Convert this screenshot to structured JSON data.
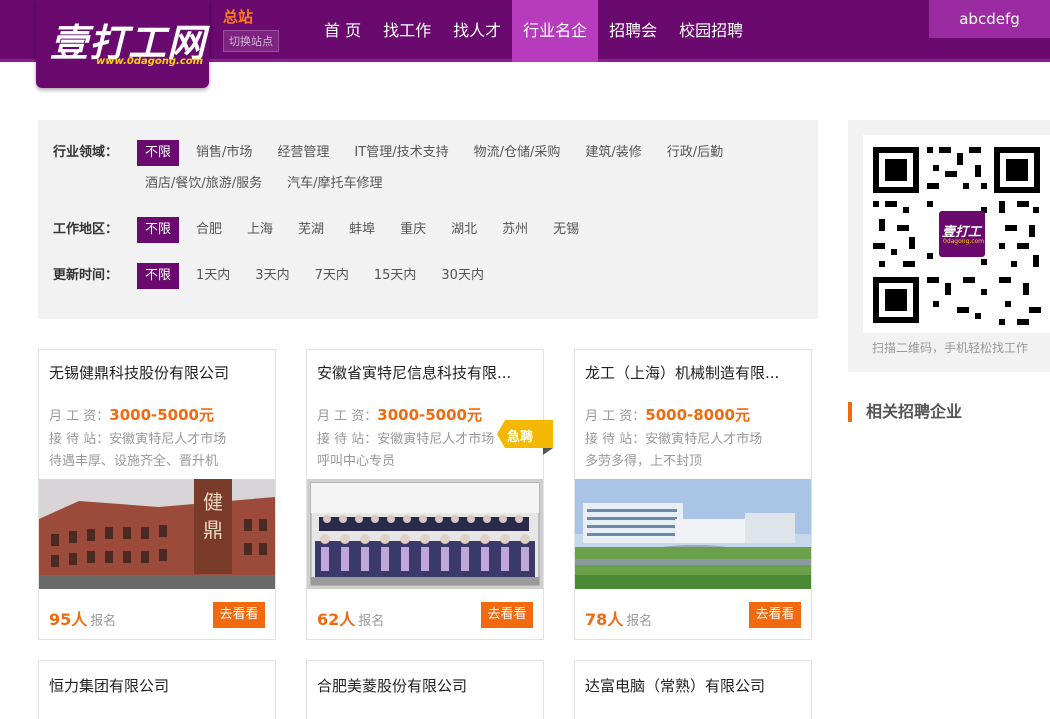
{
  "header": {
    "logo_text": "壹打工网",
    "logo_url": "www.0dagong.com",
    "site_name": "总站",
    "switch_label": "切换站点",
    "nav": [
      "首 页",
      "找工作",
      "找人才",
      "行业名企",
      "招聘会",
      "校园招聘"
    ],
    "active_nav": 3,
    "username": "abcdefg"
  },
  "filters": {
    "industry": {
      "label": "行业领域：",
      "options": [
        "不限",
        "销售/市场",
        "经营管理",
        "IT管理/技术支持",
        "物流/仓储/采购",
        "建筑/装修",
        "行政/后勤",
        "酒店/餐饮/旅游/服务",
        "汽车/摩托车修理"
      ]
    },
    "area": {
      "label": "工作地区：",
      "options": [
        "不限",
        "合肥",
        "上海",
        "芜湖",
        "蚌埠",
        "重庆",
        "湖北",
        "苏州",
        "无锡"
      ]
    },
    "updated": {
      "label": "更新时间：",
      "options": [
        "不限",
        "1天内",
        "3天内",
        "7天内",
        "15天内",
        "30天内"
      ]
    }
  },
  "cards": [
    {
      "title": "无锡健鼎科技股份有限公司",
      "salary_label": "月 工 资：",
      "salary": "3000-5000元",
      "station": "接 待 站：安徽寅特尼人才市场",
      "desc": "待遇丰厚、设施齐全、晋升机",
      "count": "95人",
      "count_suffix": "报名",
      "button": "去看看"
    },
    {
      "title": "安徽省寅特尼信息科技有限...",
      "salary_label": "月 工 资：",
      "salary": "3000-5000元",
      "station": "接 待 站：安徽寅特尼人才市场",
      "desc": "呼叫中心专员",
      "count": "62人",
      "count_suffix": "报名",
      "button": "去看看",
      "badge": "急聘"
    },
    {
      "title": "龙工（上海）机械制造有限...",
      "salary_label": "月 工 资：",
      "salary": "5000-8000元",
      "station": "接 待 站：安徽寅特尼人才市场",
      "desc": "多劳多得，上不封顶",
      "count": "78人",
      "count_suffix": "报名",
      "button": "去看看"
    }
  ],
  "cards_bottom": [
    "恒力集团有限公司",
    "合肥美菱股份有限公司",
    "达富电脑（常熟）有限公司"
  ],
  "sidebar": {
    "qr_caption": "扫描二维码，手机轻松找工作",
    "qr_logo_text": "壹打工",
    "qr_logo_url": "0dagong.com",
    "related_title": "相关招聘企业"
  },
  "colors": {
    "brand_purple": "#6a0a6e",
    "nav_active": "#b73bbd",
    "accent_orange": "#f26a0f",
    "urgent_yellow": "#f5b800"
  }
}
